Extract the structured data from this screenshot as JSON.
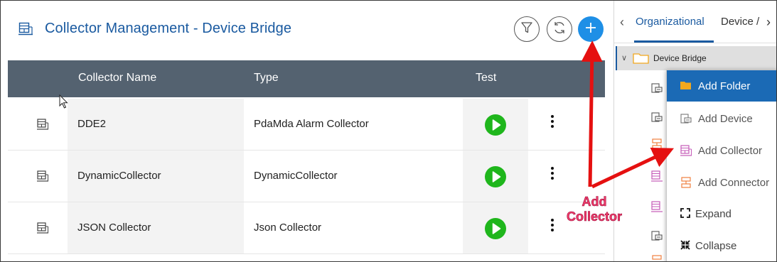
{
  "header": {
    "title": "Collector Management - Device Bridge",
    "filter_icon": "filter-icon",
    "refresh_icon": "refresh-icon",
    "add_icon": "plus-icon"
  },
  "table": {
    "columns": [
      "",
      "Collector Name",
      "Type",
      "Test",
      ""
    ],
    "rows": [
      {
        "name": "DDE2",
        "type": "PdaMda Alarm Collector"
      },
      {
        "name": "DynamicCollector",
        "type": "DynamicCollector"
      },
      {
        "name": "JSON Collector",
        "type": "Json Collector"
      }
    ]
  },
  "tree_panel": {
    "tabs": [
      "Organizational",
      "Device /"
    ],
    "root": {
      "label": "Device Bridge",
      "expanded": true
    }
  },
  "context_menu": {
    "items": [
      {
        "label": "Add Folder",
        "icon": "folder-icon",
        "highlighted": true
      },
      {
        "label": "Add Device",
        "icon": "device-icon"
      },
      {
        "label": "Add Collector",
        "icon": "collector-icon"
      },
      {
        "label": "Add Connector",
        "icon": "connector-icon"
      },
      {
        "label": "Expand",
        "icon": "expand-icon"
      },
      {
        "label": "Collapse",
        "icon": "collapse-icon"
      }
    ]
  },
  "annotation": {
    "line1": "Add",
    "line2": "Collector"
  },
  "colors": {
    "accent": "#1a5aa0",
    "add_button": "#1e8fe6",
    "table_header": "#546270",
    "play_button": "#1fb61c",
    "menu_highlight": "#1b6ab5",
    "annotation_arrow": "#e51010",
    "annotation_text": "#f03c6a"
  }
}
